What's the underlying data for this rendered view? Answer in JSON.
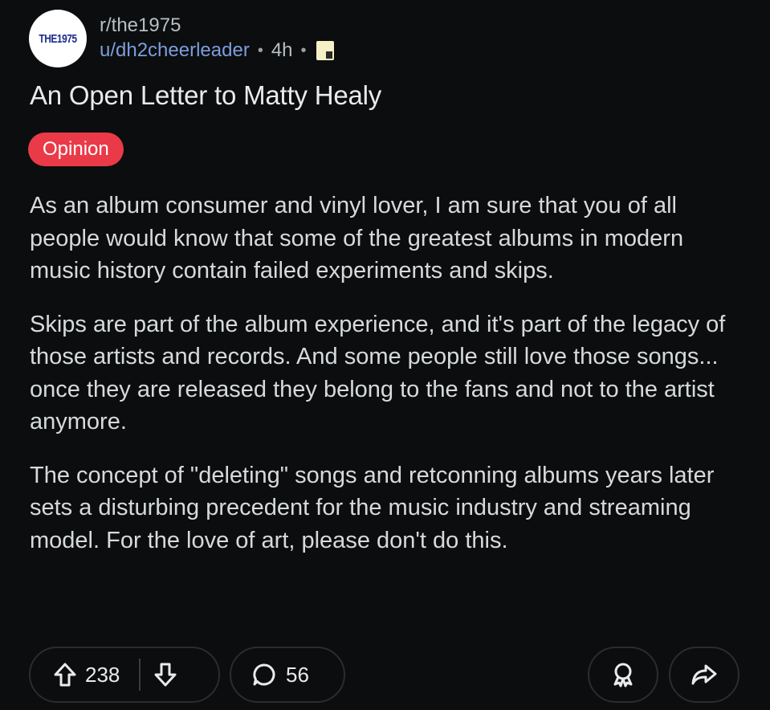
{
  "post": {
    "subreddit": "r/the1975",
    "avatar_text": "THE1975",
    "username": "u/dh2cheerleader",
    "separator": "•",
    "age": "4h",
    "title": "An Open Letter to Matty Healy",
    "flair": "Opinion",
    "paragraphs": [
      "As an album consumer and vinyl lover, I am sure that you of all people would know that some of the greatest albums in modern music history contain failed experiments and skips.",
      "Skips are part of the album experience, and it's part of the legacy of those artists and records. And some people still love those songs... once they are released they belong to the fans and not to the artist anymore.",
      "The concept of \"deleting\" songs and retconning albums years later sets a disturbing precedent for the music industry and streaming model. For the love of art, please don't do this."
    ]
  },
  "actions": {
    "upvotes": "238",
    "comments": "56",
    "icons": [
      "upvote-icon",
      "downvote-icon",
      "comment-icon",
      "award-icon",
      "share-icon"
    ]
  },
  "colors": {
    "background": "#0b0d0e",
    "username": "#7c9ede",
    "flair": "#ea3a48",
    "text": "#d7dadc"
  }
}
